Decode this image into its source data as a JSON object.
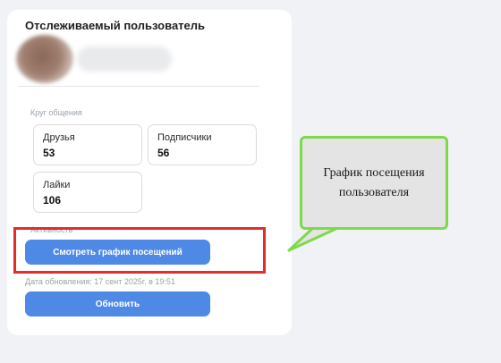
{
  "card": {
    "title": "Отслеживаемый пользователь",
    "social_circle_label": "Круг общения",
    "stats": [
      {
        "label": "Друзья",
        "value": "53"
      },
      {
        "label": "Подписчики",
        "value": "56"
      },
      {
        "label": "Лайки",
        "value": "106"
      }
    ],
    "activity_label": "Активность",
    "view_chart_button": "Смотреть график посещений",
    "update_date": "Дата обновления: 17 сент 2025г. в 19:51",
    "refresh_button": "Обновить"
  },
  "callout": {
    "text": "График посещения пользователя"
  },
  "colors": {
    "button": "#4f89e6",
    "highlight": "#e02d2d",
    "callout_border": "#7ed94b"
  }
}
